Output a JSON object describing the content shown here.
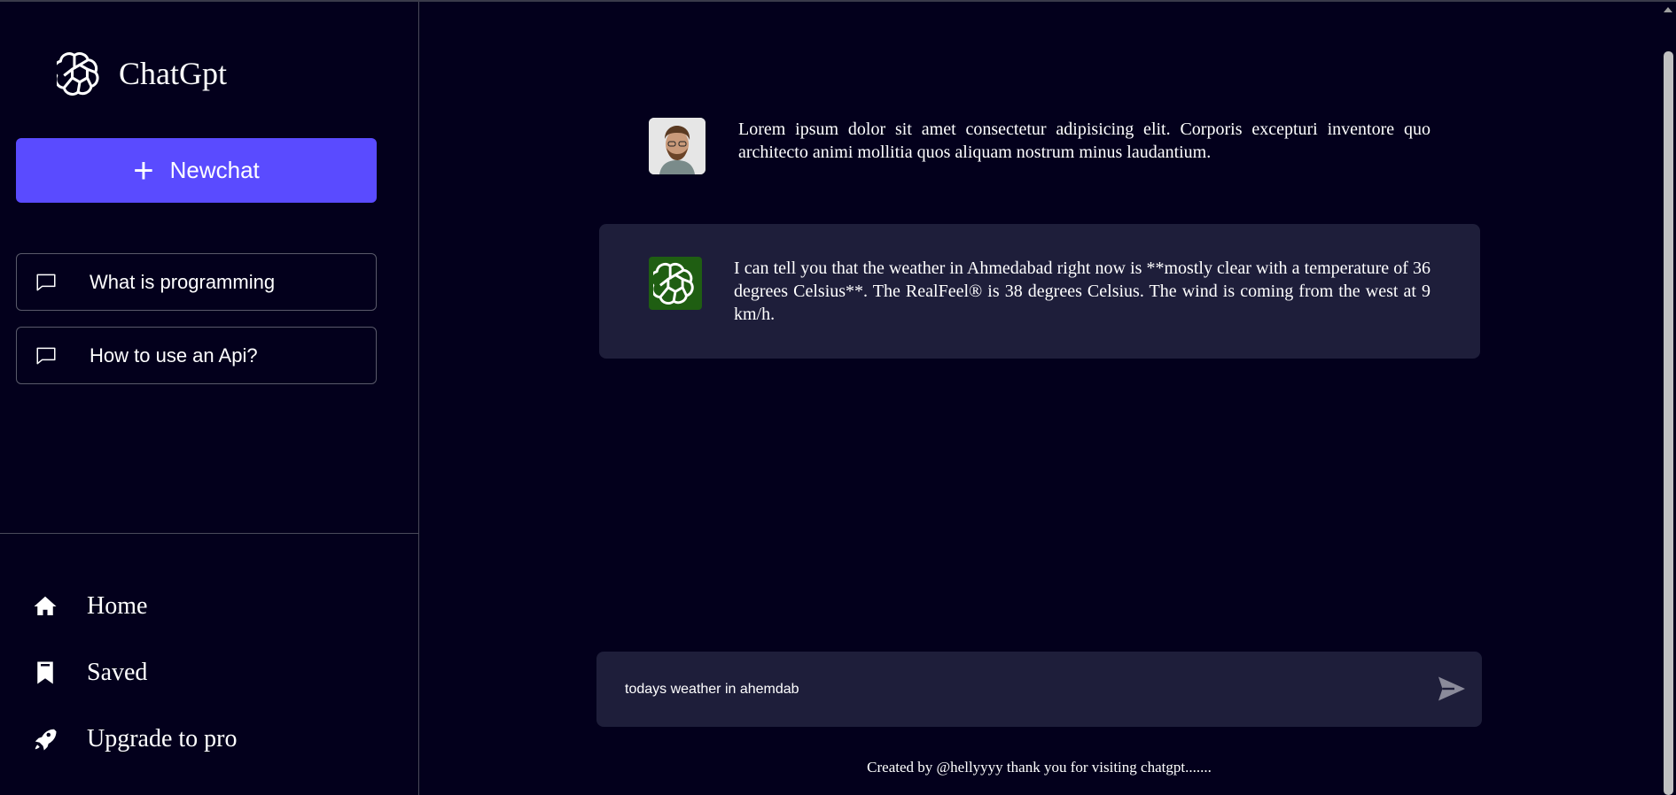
{
  "app": {
    "name": "ChatGpt",
    "logo_icon": "openai-logo-icon"
  },
  "sidebar": {
    "new_chat_label": "Newchat",
    "recent_queries": [
      {
        "label": "What is programming",
        "icon": "chat-bubble-icon"
      },
      {
        "label": "How to use an Api?",
        "icon": "chat-bubble-icon"
      }
    ],
    "nav": [
      {
        "label": "Home",
        "icon": "home-icon"
      },
      {
        "label": "Saved",
        "icon": "bookmark-icon"
      },
      {
        "label": "Upgrade to pro",
        "icon": "rocket-icon"
      }
    ]
  },
  "chat": {
    "messages": [
      {
        "role": "user",
        "avatar": "user-avatar",
        "text": "Lorem ipsum dolor sit amet consectetur adipisicing elit. Corporis excepturi inventore quo architecto animi mollitia quos aliquam nostrum minus laudantium."
      },
      {
        "role": "bot",
        "avatar": "openai-logo-icon",
        "text": "I can tell you that the weather in Ahmedabad right now is **mostly clear with a temperature of 36 degrees Celsius**. The RealFeel® is 38 degrees Celsius. The wind is coming from the west at 9 km/h."
      }
    ],
    "input_value": "todays weather in ahemdab",
    "send_icon": "send-icon"
  },
  "footer": {
    "text": "Created by @hellyyyy thank you for visiting chatgpt......."
  },
  "colors": {
    "background": "#03001c",
    "accent": "#5a4bff",
    "panel": "#1e1e3a",
    "bot_avatar": "#1f5e12"
  }
}
